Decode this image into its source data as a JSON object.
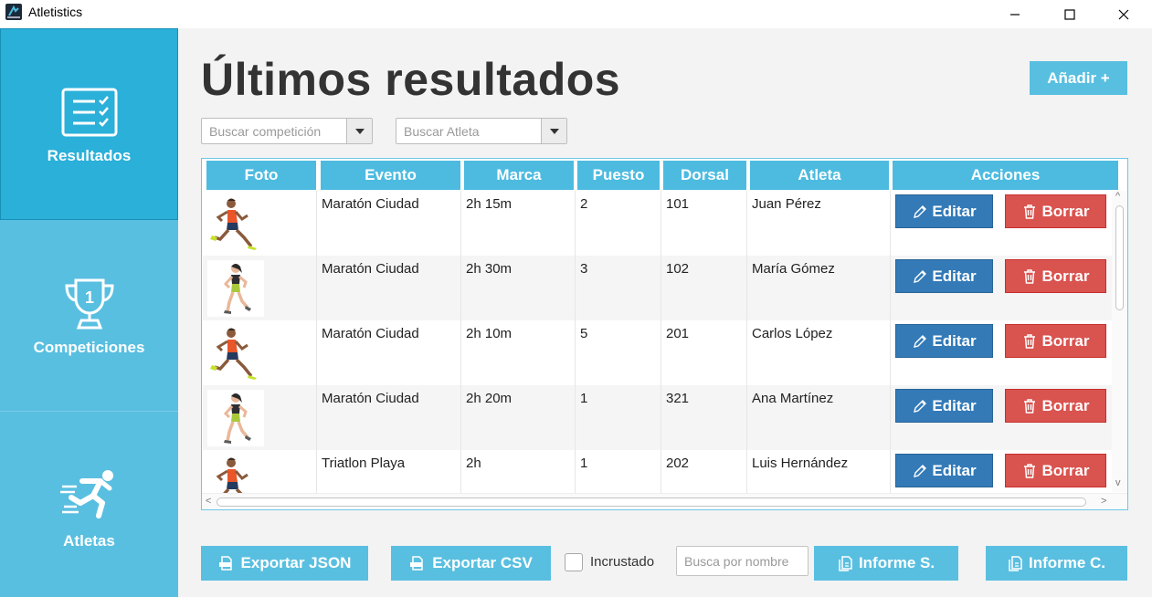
{
  "window": {
    "title": "Atletistics"
  },
  "sidebar": {
    "items": [
      {
        "label": "Resultados",
        "icon": "checklist-icon",
        "active": true
      },
      {
        "label": "Competiciones",
        "icon": "trophy-icon",
        "active": false
      },
      {
        "label": "Atletas",
        "icon": "runner-icon",
        "active": false
      }
    ]
  },
  "main": {
    "title": "Últimos resultados",
    "add_label": "Añadir +",
    "search_competition_placeholder": "Buscar competición",
    "search_athlete_placeholder": "Buscar Atleta"
  },
  "table": {
    "columns": [
      "Foto",
      "Evento",
      "Marca",
      "Puesto",
      "Dorsal",
      "Atleta",
      "Acciones"
    ],
    "rows": [
      {
        "photo": "male-runner",
        "evento": "Maratón Ciudad",
        "marca": "2h 15m",
        "puesto": "2",
        "dorsal": "101",
        "atleta": "Juan Pérez"
      },
      {
        "photo": "female-runner",
        "evento": "Maratón Ciudad",
        "marca": "2h 30m",
        "puesto": "3",
        "dorsal": "102",
        "atleta": "María Gómez"
      },
      {
        "photo": "male-runner",
        "evento": "Maratón Ciudad",
        "marca": "2h 10m",
        "puesto": "5",
        "dorsal": "201",
        "atleta": "Carlos López"
      },
      {
        "photo": "female-runner",
        "evento": "Maratón Ciudad",
        "marca": "2h 20m",
        "puesto": "1",
        "dorsal": "321",
        "atleta": "Ana Martínez"
      },
      {
        "photo": "male-runner",
        "evento": "Triatlon Playa",
        "marca": "2h",
        "puesto": "1",
        "dorsal": "202",
        "atleta": "Luis Hernández"
      }
    ],
    "edit_label": "Editar",
    "delete_label": "Borrar"
  },
  "footer": {
    "export_json_label": "Exportar JSON",
    "export_csv_label": "Exportar CSV",
    "embedded_label": "Incrustado",
    "embedded_checked": false,
    "search_name_placeholder": "Busca por nombre",
    "report_s_label": "Informe S.",
    "report_c_label": "Informe C."
  },
  "colors": {
    "sidebar": "#59bfe0",
    "sidebar_active": "#2ab0d9",
    "header_cell": "#4dbbe0",
    "edit_button": "#337ab7",
    "delete_button": "#d9534f"
  }
}
